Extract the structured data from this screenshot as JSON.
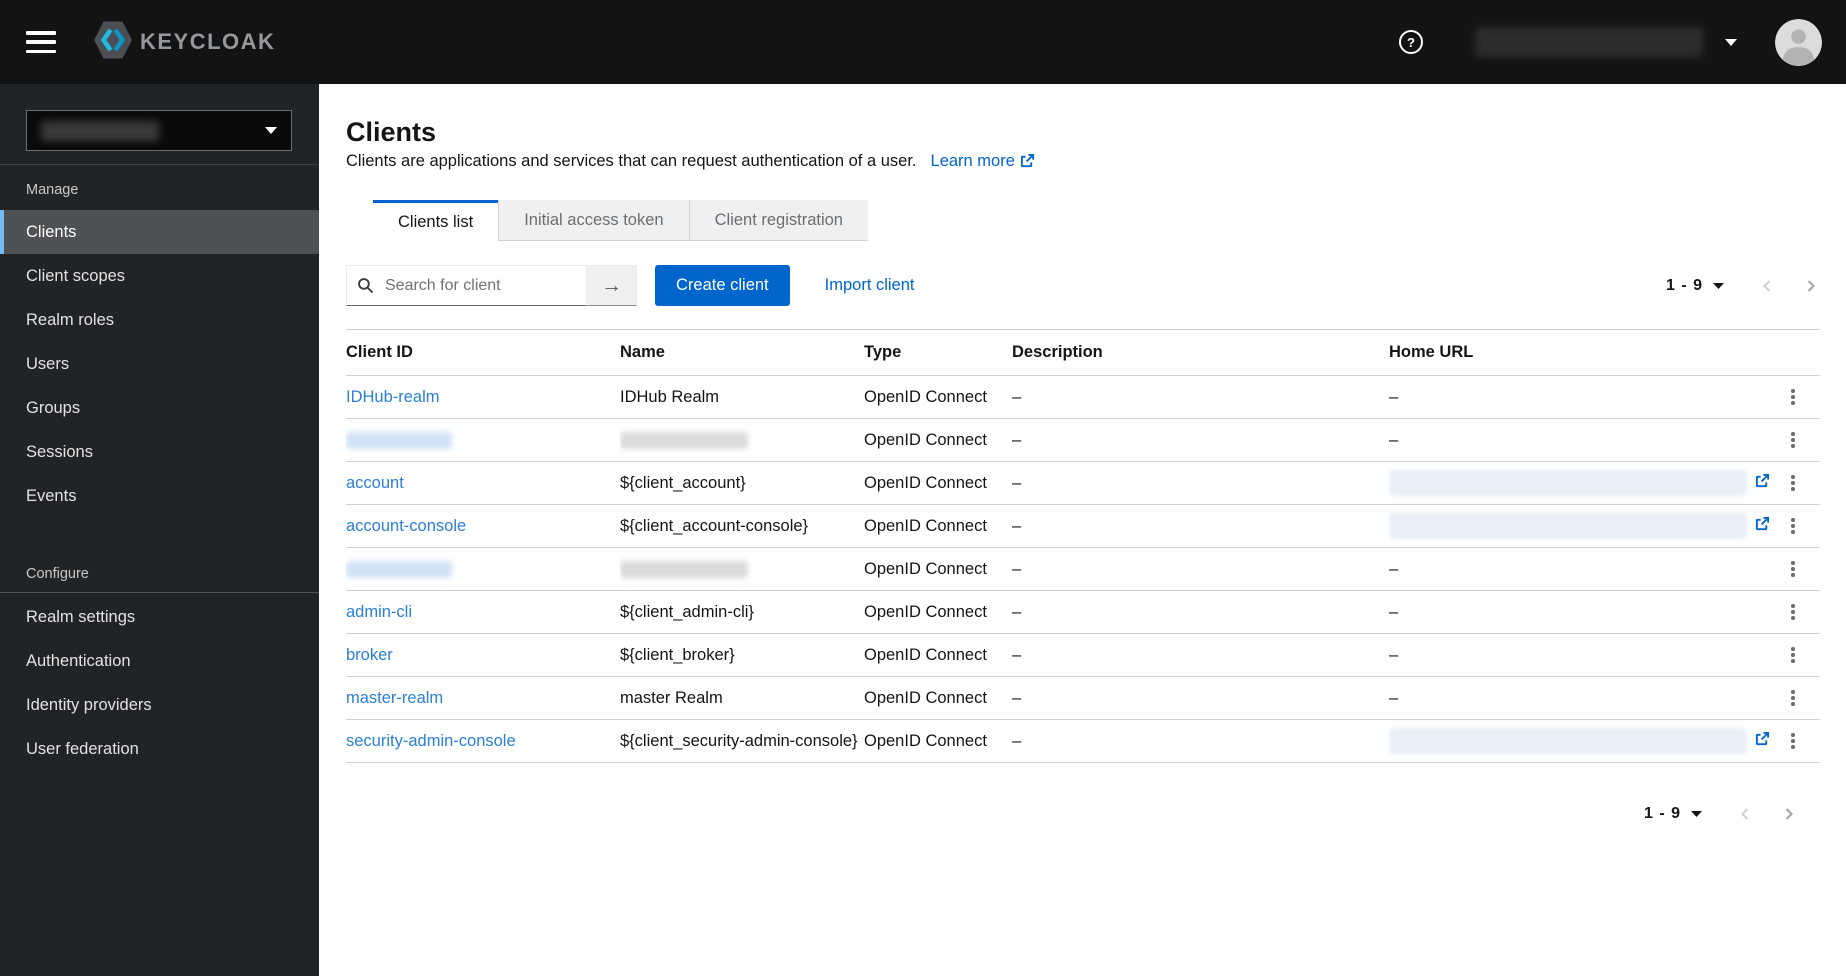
{
  "colors": {
    "accent_blue": "#0066cc",
    "masthead_bg": "#131313",
    "sidebar_bg": "#212427",
    "nav_active_indicator": "#73bcf7",
    "table_link_blue": "#2b7fd6",
    "inactive_tab_bg": "#f0f0f0"
  },
  "masthead": {
    "brand_text": "KEYCLOAK",
    "help_label": "?"
  },
  "sidebar": {
    "realm_selector_redacted": true,
    "sections": [
      {
        "label": "Manage",
        "items": [
          {
            "label": "Clients",
            "active": true
          },
          {
            "label": "Client scopes",
            "active": false
          },
          {
            "label": "Realm roles",
            "active": false
          },
          {
            "label": "Users",
            "active": false
          },
          {
            "label": "Groups",
            "active": false
          },
          {
            "label": "Sessions",
            "active": false
          },
          {
            "label": "Events",
            "active": false
          }
        ]
      },
      {
        "label": "Configure",
        "items": [
          {
            "label": "Realm settings",
            "active": false
          },
          {
            "label": "Authentication",
            "active": false
          },
          {
            "label": "Identity providers",
            "active": false
          },
          {
            "label": "User federation",
            "active": false
          }
        ]
      }
    ]
  },
  "page": {
    "title": "Clients",
    "description": "Clients are applications and services that can request authentication of a user.",
    "learn_more_label": "Learn more"
  },
  "tabs": [
    {
      "label": "Clients list",
      "active": true
    },
    {
      "label": "Initial access token",
      "active": false
    },
    {
      "label": "Client registration",
      "active": false
    }
  ],
  "toolbar": {
    "search_placeholder": "Search for client",
    "create_button_label": "Create client",
    "import_link_label": "Import client",
    "pagination_label": "1 - 9"
  },
  "table": {
    "columns": [
      "Client ID",
      "Name",
      "Type",
      "Description",
      "Home URL"
    ],
    "rows": [
      {
        "client_id": "IDHub-realm",
        "name": "IDHub Realm",
        "type": "OpenID Connect",
        "description": "–",
        "home_url": "–",
        "client_id_redacted": false,
        "name_redacted": false,
        "home_url_redacted": false,
        "home_url_external": false
      },
      {
        "client_id": null,
        "name": null,
        "type": "OpenID Connect",
        "description": "–",
        "home_url": "–",
        "client_id_redacted": true,
        "name_redacted": true,
        "home_url_redacted": false,
        "home_url_external": false
      },
      {
        "client_id": "account",
        "name": "${client_account}",
        "type": "OpenID Connect",
        "description": "–",
        "home_url": null,
        "client_id_redacted": false,
        "name_redacted": false,
        "home_url_redacted": true,
        "home_url_external": true
      },
      {
        "client_id": "account-console",
        "name": "${client_account-console}",
        "type": "OpenID Connect",
        "description": "–",
        "home_url": null,
        "client_id_redacted": false,
        "name_redacted": false,
        "home_url_redacted": true,
        "home_url_external": true
      },
      {
        "client_id": null,
        "name": null,
        "type": "OpenID Connect",
        "description": "–",
        "home_url": "–",
        "client_id_redacted": true,
        "name_redacted": true,
        "home_url_redacted": false,
        "home_url_external": false
      },
      {
        "client_id": "admin-cli",
        "name": "${client_admin-cli}",
        "type": "OpenID Connect",
        "description": "–",
        "home_url": "–",
        "client_id_redacted": false,
        "name_redacted": false,
        "home_url_redacted": false,
        "home_url_external": false
      },
      {
        "client_id": "broker",
        "name": "${client_broker}",
        "type": "OpenID Connect",
        "description": "–",
        "home_url": "–",
        "client_id_redacted": false,
        "name_redacted": false,
        "home_url_redacted": false,
        "home_url_external": false
      },
      {
        "client_id": "master-realm",
        "name": "master Realm",
        "type": "OpenID Connect",
        "description": "–",
        "home_url": "–",
        "client_id_redacted": false,
        "name_redacted": false,
        "home_url_redacted": false,
        "home_url_external": false
      },
      {
        "client_id": "security-admin-console",
        "name": "${client_security-admin-console}",
        "type": "OpenID Connect",
        "description": "–",
        "home_url": null,
        "client_id_redacted": false,
        "name_redacted": false,
        "home_url_redacted": true,
        "home_url_external": true
      }
    ]
  },
  "pagination_bottom": {
    "label": "1 - 9"
  }
}
